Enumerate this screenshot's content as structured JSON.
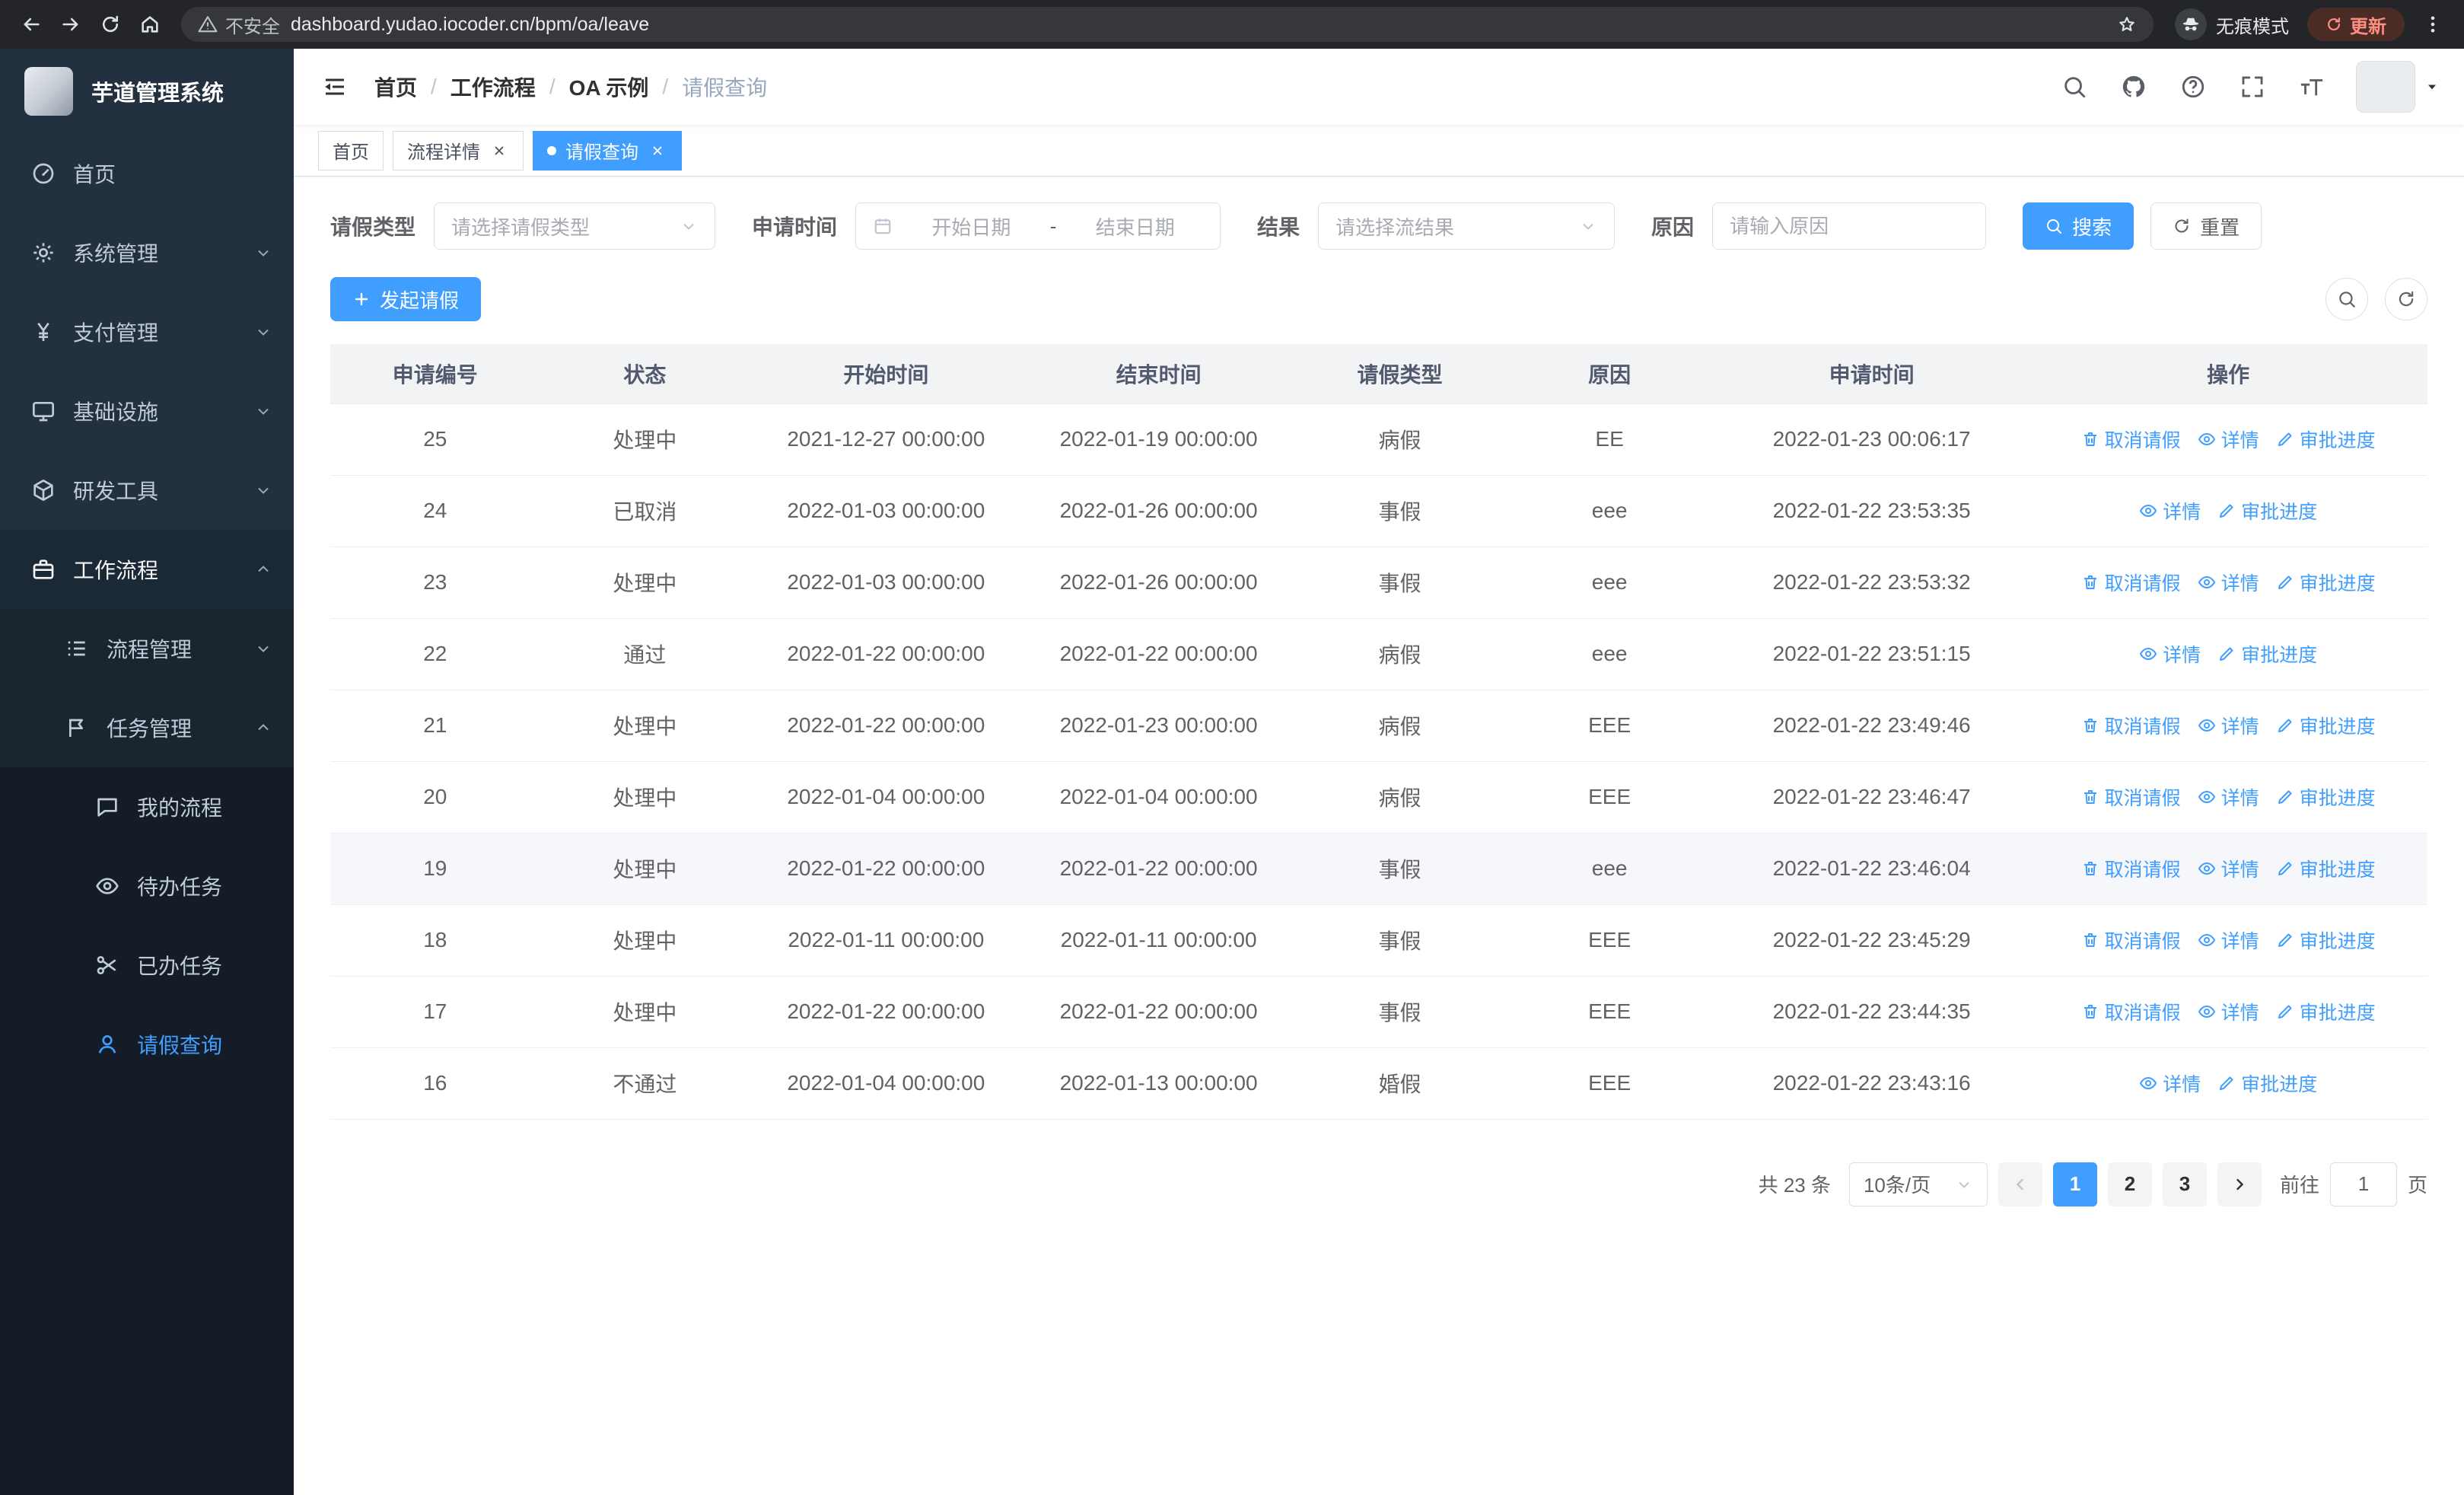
{
  "colors": {
    "primary": "#409eff",
    "sidebar_bg": "#22303f"
  },
  "browser": {
    "security_label": "不安全",
    "url": "dashboard.yudao.iocoder.cn/bpm/oa/leave",
    "incognito_label": "无痕模式",
    "update_label": "更新"
  },
  "sidebar": {
    "logo_title": "芋道管理系统",
    "items": [
      {
        "label": "首页",
        "icon": "dashboard-icon"
      },
      {
        "label": "系统管理",
        "icon": "gear-icon"
      },
      {
        "label": "支付管理",
        "icon": "yen-icon"
      },
      {
        "label": "基础设施",
        "icon": "monitor-icon"
      },
      {
        "label": "研发工具",
        "icon": "cube-icon"
      },
      {
        "label": "工作流程",
        "icon": "briefcase-icon"
      },
      {
        "label": "流程管理",
        "icon": "list-icon"
      },
      {
        "label": "任务管理",
        "icon": "flag-icon"
      },
      {
        "label": "我的流程",
        "icon": "message-icon"
      },
      {
        "label": "待办任务",
        "icon": "eye-icon"
      },
      {
        "label": "已办任务",
        "icon": "scissors-icon"
      },
      {
        "label": "请假查询",
        "icon": "user-icon"
      }
    ]
  },
  "header": {
    "breadcrumb": [
      "首页",
      "工作流程",
      "OA 示例",
      "请假查询"
    ],
    "separator": "/"
  },
  "tags": [
    {
      "label": "首页"
    },
    {
      "label": "流程详情"
    },
    {
      "label": "请假查询"
    }
  ],
  "filters": {
    "leave_type_label": "请假类型",
    "leave_type_placeholder": "请选择请假类型",
    "apply_time_label": "申请时间",
    "start_date_placeholder": "开始日期",
    "range_separator": "-",
    "end_date_placeholder": "结束日期",
    "result_label": "结果",
    "result_placeholder": "请选择流结果",
    "reason_label": "原因",
    "reason_placeholder": "请输入原因",
    "search_label": "搜索",
    "reset_label": "重置"
  },
  "toolbar": {
    "create_label": "发起请假"
  },
  "table": {
    "columns": [
      "申请编号",
      "状态",
      "开始时间",
      "结束时间",
      "请假类型",
      "原因",
      "申请时间",
      "操作"
    ],
    "action_labels": {
      "cancel": "取消请假",
      "detail": "详情",
      "progress": "审批进度"
    },
    "action_icons": {
      "cancel": "delete-icon",
      "detail": "view-icon",
      "progress": "edit-icon"
    },
    "rows": [
      {
        "id": "25",
        "status": "处理中",
        "start": "2021-12-27 00:00:00",
        "end": "2022-01-19 00:00:00",
        "type": "病假",
        "reason": "EE",
        "applied": "2022-01-23 00:06:17",
        "actions": [
          "cancel",
          "detail",
          "progress"
        ],
        "highlight": false
      },
      {
        "id": "24",
        "status": "已取消",
        "start": "2022-01-03 00:00:00",
        "end": "2022-01-26 00:00:00",
        "type": "事假",
        "reason": "eee",
        "applied": "2022-01-22 23:53:35",
        "actions": [
          "detail",
          "progress"
        ],
        "highlight": false
      },
      {
        "id": "23",
        "status": "处理中",
        "start": "2022-01-03 00:00:00",
        "end": "2022-01-26 00:00:00",
        "type": "事假",
        "reason": "eee",
        "applied": "2022-01-22 23:53:32",
        "actions": [
          "cancel",
          "detail",
          "progress"
        ],
        "highlight": false
      },
      {
        "id": "22",
        "status": "通过",
        "start": "2022-01-22 00:00:00",
        "end": "2022-01-22 00:00:00",
        "type": "病假",
        "reason": "eee",
        "applied": "2022-01-22 23:51:15",
        "actions": [
          "detail",
          "progress"
        ],
        "highlight": false
      },
      {
        "id": "21",
        "status": "处理中",
        "start": "2022-01-22 00:00:00",
        "end": "2022-01-23 00:00:00",
        "type": "病假",
        "reason": "EEE",
        "applied": "2022-01-22 23:49:46",
        "actions": [
          "cancel",
          "detail",
          "progress"
        ],
        "highlight": false
      },
      {
        "id": "20",
        "status": "处理中",
        "start": "2022-01-04 00:00:00",
        "end": "2022-01-04 00:00:00",
        "type": "病假",
        "reason": "EEE",
        "applied": "2022-01-22 23:46:47",
        "actions": [
          "cancel",
          "detail",
          "progress"
        ],
        "highlight": false
      },
      {
        "id": "19",
        "status": "处理中",
        "start": "2022-01-22 00:00:00",
        "end": "2022-01-22 00:00:00",
        "type": "事假",
        "reason": "eee",
        "applied": "2022-01-22 23:46:04",
        "actions": [
          "cancel",
          "detail",
          "progress"
        ],
        "highlight": true
      },
      {
        "id": "18",
        "status": "处理中",
        "start": "2022-01-11 00:00:00",
        "end": "2022-01-11 00:00:00",
        "type": "事假",
        "reason": "EEE",
        "applied": "2022-01-22 23:45:29",
        "actions": [
          "cancel",
          "detail",
          "progress"
        ],
        "highlight": false
      },
      {
        "id": "17",
        "status": "处理中",
        "start": "2022-01-22 00:00:00",
        "end": "2022-01-22 00:00:00",
        "type": "事假",
        "reason": "EEE",
        "applied": "2022-01-22 23:44:35",
        "actions": [
          "cancel",
          "detail",
          "progress"
        ],
        "highlight": false
      },
      {
        "id": "16",
        "status": "不通过",
        "start": "2022-01-04 00:00:00",
        "end": "2022-01-13 00:00:00",
        "type": "婚假",
        "reason": "EEE",
        "applied": "2022-01-22 23:43:16",
        "actions": [
          "detail",
          "progress"
        ],
        "highlight": false
      }
    ]
  },
  "pagination": {
    "total_text": "共 23 条",
    "page_size": "10条/页",
    "pages": [
      "1",
      "2",
      "3"
    ],
    "active_page": "1",
    "goto_label": "前往",
    "goto_value": "1",
    "page_unit": "页"
  }
}
